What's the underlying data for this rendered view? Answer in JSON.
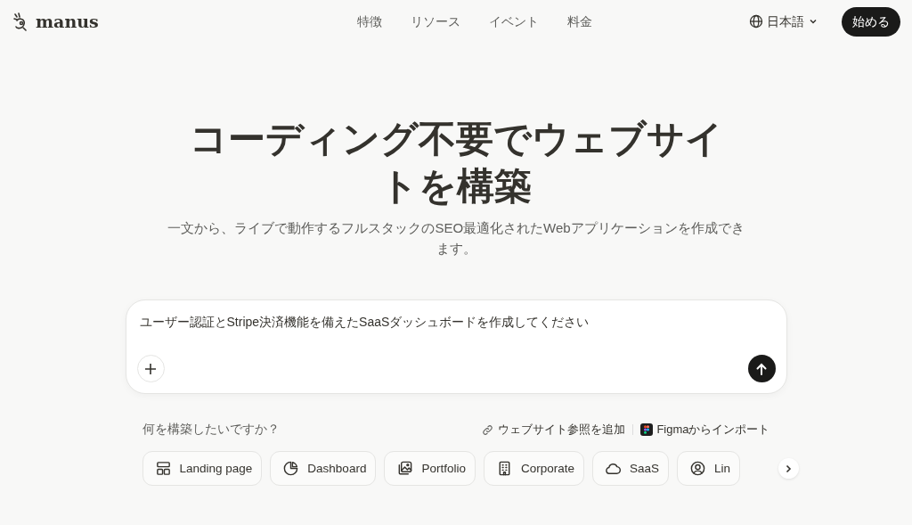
{
  "navbar": {
    "logo": "manus",
    "links": [
      "特徴",
      "リソース",
      "イベント",
      "料金"
    ],
    "language": "日本語",
    "cta": "始める"
  },
  "hero": {
    "title": "コーディング不要でウェブサイトを構築",
    "subtitle": "一文から、ライブで動作するフルスタックのSEO最適化されたWebアプリケーションを作成できます。"
  },
  "prompt": {
    "value": "ユーザー認証とStripe決済機能を備えたSaaSダッシュボードを作成してください"
  },
  "suggestions": {
    "question": "何を構築したいですか？",
    "actions": [
      {
        "kind": "link",
        "label": "ウェブサイト参照を追加"
      },
      {
        "kind": "figma",
        "label": "Figmaからインポート"
      }
    ],
    "chips": [
      {
        "kind": "layout",
        "label": "Landing page"
      },
      {
        "kind": "chart",
        "label": "Dashboard"
      },
      {
        "kind": "image",
        "label": "Portfolio"
      },
      {
        "kind": "building",
        "label": "Corporate"
      },
      {
        "kind": "cloud",
        "label": "SaaS"
      },
      {
        "kind": "user",
        "label": "Lin"
      }
    ]
  }
}
